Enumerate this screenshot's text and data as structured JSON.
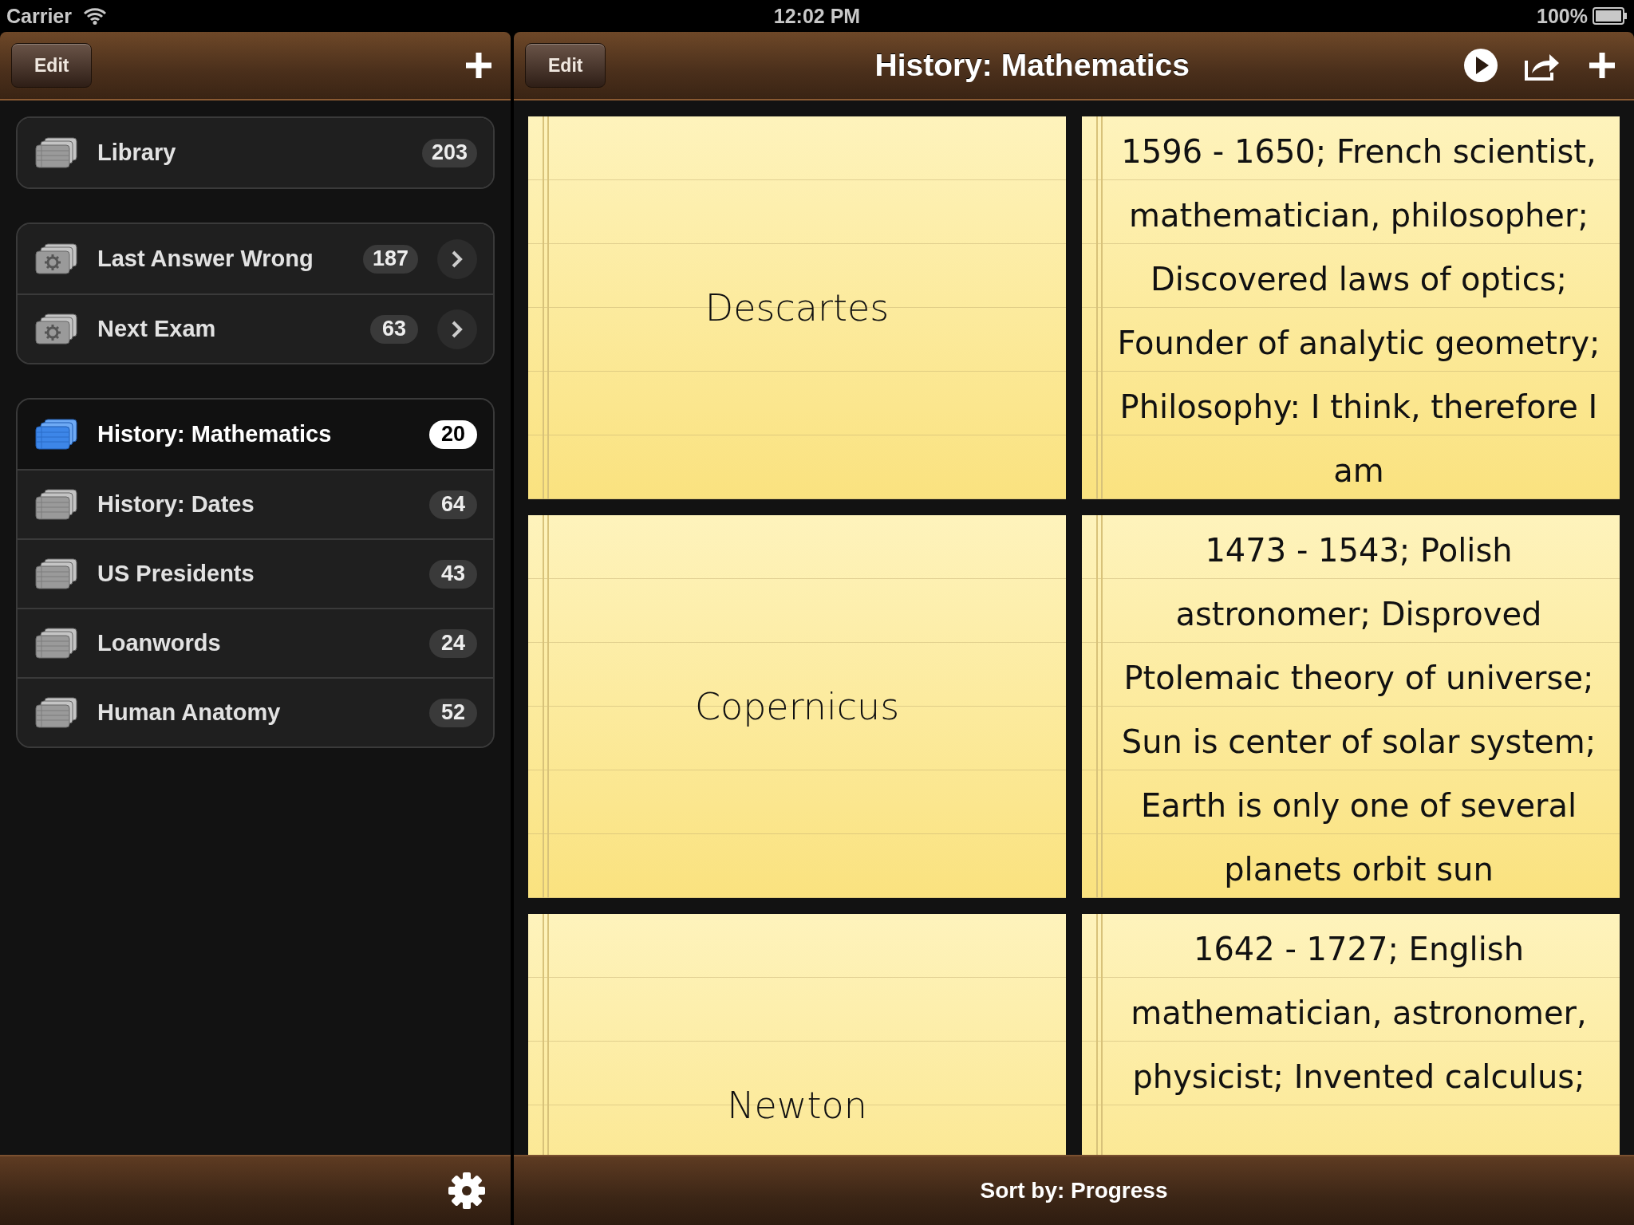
{
  "status_bar": {
    "carrier": "Carrier",
    "time": "12:02 PM",
    "battery": "100%"
  },
  "sidebar": {
    "edit_label": "Edit",
    "groups": [
      {
        "items": [
          {
            "label": "Library",
            "count": "203",
            "kind": "library",
            "selected": false
          }
        ]
      },
      {
        "items": [
          {
            "label": "Last Answer Wrong",
            "count": "187",
            "kind": "smart",
            "selected": false
          },
          {
            "label": "Next Exam",
            "count": "63",
            "kind": "smart",
            "selected": false
          }
        ]
      },
      {
        "items": [
          {
            "label": "History: Mathematics",
            "count": "20",
            "kind": "deck",
            "selected": true
          },
          {
            "label": "History: Dates",
            "count": "64",
            "kind": "deck",
            "selected": false
          },
          {
            "label": "US Presidents",
            "count": "43",
            "kind": "deck",
            "selected": false
          },
          {
            "label": "Loanwords",
            "count": "24",
            "kind": "deck",
            "selected": false
          },
          {
            "label": "Human Anatomy",
            "count": "52",
            "kind": "deck",
            "selected": false
          }
        ]
      }
    ]
  },
  "main": {
    "edit_label": "Edit",
    "title": "History: Mathematics",
    "cards": [
      {
        "front": "Descartes",
        "back": "1596 - 1650; French scientist, mathematician, philosopher; Discovered laws of optics; Founder of analytic geometry; Philosophy: I think, therefore I am"
      },
      {
        "front": "Copernicus",
        "back": "1473 - 1543; Polish astronomer; Disproved Ptolemaic theory of universe; Sun is center of solar system; Earth is only one of several planets orbit sun"
      },
      {
        "front": "Newton",
        "back": "1642 - 1727; English mathematician, astronomer, physicist; Invented calculus;"
      }
    ],
    "sort_label": "Sort by: Progress"
  }
}
